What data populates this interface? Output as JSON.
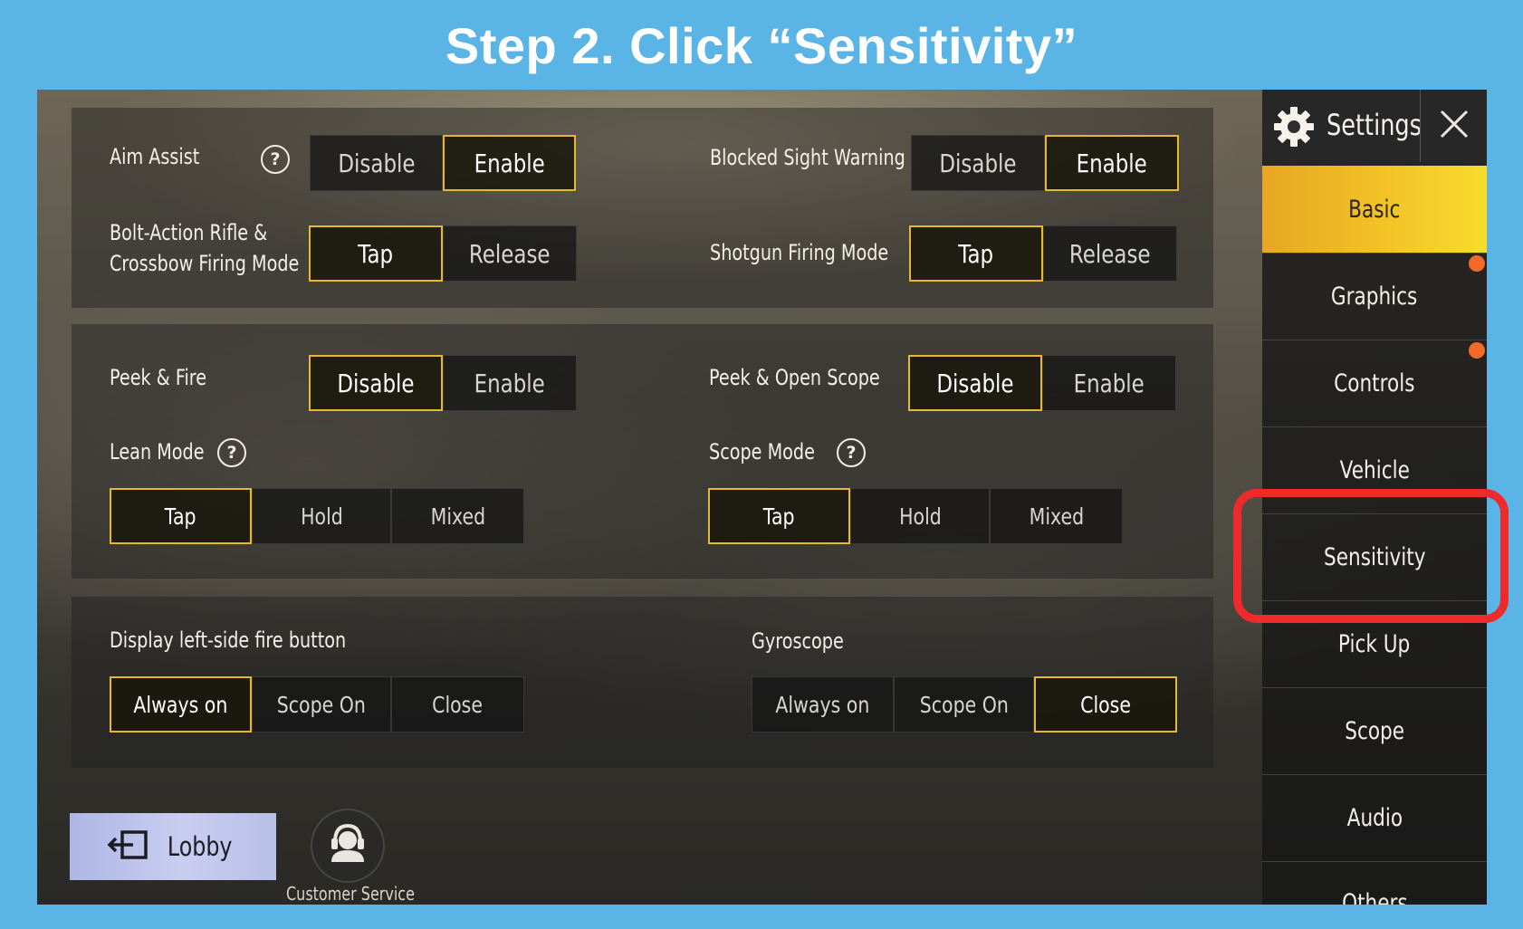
{
  "banner": {
    "title": "Step 2. Click “Sensitivity”"
  },
  "settings": {
    "aim_assist": {
      "label": "Aim Assist",
      "options": [
        "Disable",
        "Enable"
      ],
      "selected": "Enable"
    },
    "blocked_sight_warning": {
      "label": "Blocked Sight Warning",
      "options": [
        "Disable",
        "Enable"
      ],
      "selected": "Enable"
    },
    "bolt_action": {
      "label_line1": "Bolt-Action Rifle &",
      "label_line2": "Crossbow Firing Mode",
      "options": [
        "Tap",
        "Release"
      ],
      "selected": "Tap"
    },
    "shotgun_firing_mode": {
      "label": "Shotgun Firing Mode",
      "options": [
        "Tap",
        "Release"
      ],
      "selected": "Tap"
    },
    "peek_fire": {
      "label": "Peek & Fire",
      "options": [
        "Disable",
        "Enable"
      ],
      "selected": "Disable"
    },
    "peek_open_scope": {
      "label": "Peek & Open Scope",
      "options": [
        "Disable",
        "Enable"
      ],
      "selected": "Disable"
    },
    "lean_mode": {
      "label": "Lean Mode",
      "options": [
        "Tap",
        "Hold",
        "Mixed"
      ],
      "selected": "Tap"
    },
    "scope_mode": {
      "label": "Scope Mode",
      "options": [
        "Tap",
        "Hold",
        "Mixed"
      ],
      "selected": "Tap"
    },
    "left_fire_button": {
      "label": "Display left-side fire button",
      "options": [
        "Always on",
        "Scope On",
        "Close"
      ],
      "selected": "Always on"
    },
    "gyroscope": {
      "label": "Gyroscope",
      "options": [
        "Always on",
        "Scope On",
        "Close"
      ],
      "selected": "Close"
    },
    "help_glyph": "?"
  },
  "sidebar": {
    "title": "Settings",
    "items": [
      {
        "label": "Basic",
        "active": true,
        "badge": false
      },
      {
        "label": "Graphics",
        "active": false,
        "badge": true
      },
      {
        "label": "Controls",
        "active": false,
        "badge": true
      },
      {
        "label": "Vehicle",
        "active": false,
        "badge": false
      },
      {
        "label": "Sensitivity",
        "active": false,
        "badge": false
      },
      {
        "label": "Pick Up",
        "active": false,
        "badge": false
      },
      {
        "label": "Scope",
        "active": false,
        "badge": false
      },
      {
        "label": "Audio",
        "active": false,
        "badge": false
      },
      {
        "label": "Others",
        "active": false,
        "badge": false
      }
    ]
  },
  "bottom": {
    "lobby_label": "Lobby",
    "customer_service_label": "Customer Service"
  },
  "colors": {
    "background": "#5ab4e6",
    "selected_border": "#e6b82a",
    "active_tab": "#f2c326",
    "highlight": "#ee2a2a",
    "badge": "#f26a2a"
  },
  "icons": [
    "gear-icon",
    "close-icon",
    "help-icon",
    "exit-icon",
    "headset-icon"
  ]
}
